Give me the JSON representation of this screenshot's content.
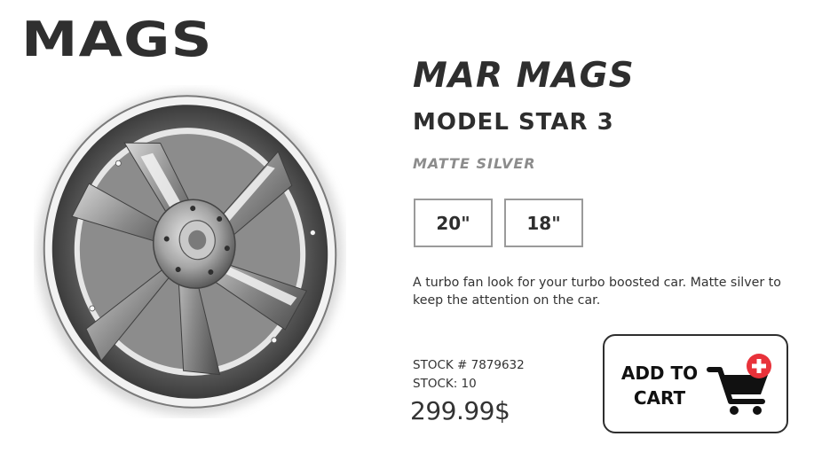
{
  "header": {
    "logo_text": "MAGS"
  },
  "product": {
    "image_icon": "wheel-image",
    "brand": "MAR MAGS",
    "model": "MODEL STAR 3",
    "finish": "MATTE SILVER",
    "sizes": [
      "20\"",
      "18\""
    ],
    "description": "A turbo fan look for your turbo boosted car. Matte silver to keep the attention on the car.",
    "stock_number": "STOCK # 7879632",
    "stock_count": "STOCK: 10",
    "price": "299.99$"
  },
  "cart": {
    "label_line1": "ADD TO",
    "label_line2": "CART",
    "icon": "cart-add-icon",
    "accent_color": "#e8323a"
  }
}
